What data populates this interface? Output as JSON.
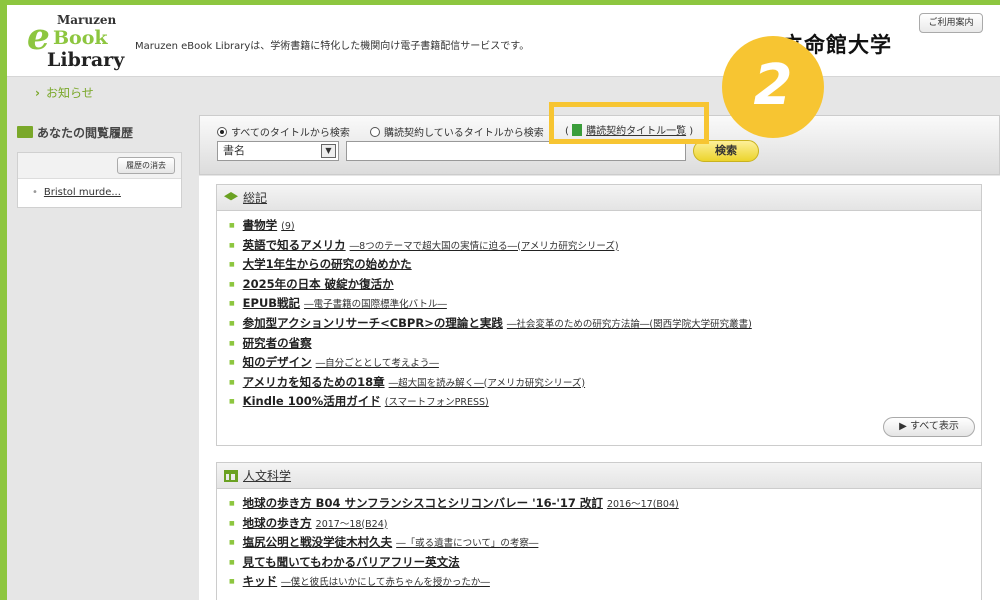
{
  "header": {
    "logo_line1": "Maruzen",
    "logo_e": "e",
    "logo_line2": "Book",
    "logo_line3": "Library",
    "tagline": "Maruzen eBook Libraryは、学術書籍に特化した機関向け電子書籍配信サービスです。",
    "university": "立命館大学",
    "help_label": "ご利用案内"
  },
  "news": {
    "label": "お知らせ"
  },
  "sidebar": {
    "title": "あなたの閲覧履歴",
    "clear_label": "履歴の消去",
    "history": [
      "Bristol murde..."
    ]
  },
  "search": {
    "radio_all": "すべてのタイトルから検索",
    "radio_contract": "購読契約しているタイトルから検索",
    "paren_open": "(",
    "contract_list": "購読契約タイトル一覧",
    "paren_close": ")",
    "field_select": "書名",
    "button": "検索",
    "step_badge": "2"
  },
  "sections": [
    {
      "title": "総記",
      "show_all": "すべて表示",
      "books": [
        {
          "title": "書物学",
          "sub": "(9)"
        },
        {
          "title": "英語で知るアメリカ",
          "sub": "―8つのテーマで超大国の実情に迫る―(アメリカ研究シリーズ)"
        },
        {
          "title": "大学1年生からの研究の始めかた",
          "sub": ""
        },
        {
          "title": "2025年の日本 破綻か復活か",
          "sub": ""
        },
        {
          "title": "EPUB戦記",
          "sub": "―電子書籍の国際標準化バトル―"
        },
        {
          "title": "参加型アクションリサーチ<CBPR>の理論と実践",
          "sub": "―社会変革のための研究方法論―(関西学院大学研究叢書)"
        },
        {
          "title": "研究者の省察",
          "sub": ""
        },
        {
          "title": "知のデザイン",
          "sub": "―自分ごととして考えよう―"
        },
        {
          "title": "アメリカを知るための18章",
          "sub": "―超大国を読み解く―(アメリカ研究シリーズ)"
        },
        {
          "title": "Kindle 100%活用ガイド",
          "sub": "(スマートフォンPRESS)"
        }
      ]
    },
    {
      "title": "人文科学",
      "books": [
        {
          "title": "地球の歩き方 B04 サンフランシスコとシリコンバレー '16-'17 改訂",
          "sub": "2016～17(B04)"
        },
        {
          "title": "地球の歩き方",
          "sub": "2017～18(B24)"
        },
        {
          "title": "塩尻公明と戦没学徒木村久夫",
          "sub": "―「或る遺書について」の考察―"
        },
        {
          "title": "見ても聞いてもわかるバリアフリー英文法",
          "sub": ""
        },
        {
          "title": "キッド",
          "sub": "―僕と彼氏はいかにして赤ちゃんを授かったか―"
        }
      ]
    }
  ]
}
